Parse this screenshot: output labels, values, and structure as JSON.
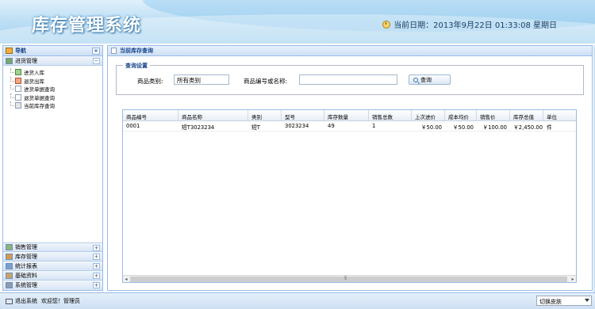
{
  "header": {
    "app_title": "库存管理系统",
    "date_text": "当前日期：2013年9月22日  01:33:08 星期日"
  },
  "nav": {
    "title": "导航",
    "collapse_symbol": "«",
    "sections_top": [
      {
        "label": "进货管理",
        "toggle": "−",
        "items": [
          "进货入库",
          "退货出库",
          "进货单据查询",
          "退货单据查询",
          "当前库存查询"
        ]
      }
    ],
    "sections_bottom": [
      {
        "label": "销售管理",
        "toggle": "+"
      },
      {
        "label": "库存管理",
        "toggle": "+"
      },
      {
        "label": "统计报表",
        "toggle": "+"
      },
      {
        "label": "基础资料",
        "toggle": "+"
      },
      {
        "label": "系统管理",
        "toggle": "+"
      }
    ]
  },
  "main": {
    "panel_title": "当前库存查询",
    "query": {
      "legend": "查询设置",
      "category_label": "商品类别:",
      "category_value": "所有类别",
      "code_label": "商品编号或名称:",
      "code_value": "",
      "search_button": "查询"
    },
    "grid": {
      "columns": [
        "商品编号",
        "商品名称",
        "类别",
        "型号",
        "库存数量",
        "销售总数",
        "上次进价",
        "成本均价",
        "销售价",
        "库存总值",
        "单位"
      ],
      "rows": [
        [
          "0001",
          "短T3023234",
          "短T",
          "3023234",
          "49",
          "1",
          "￥50.00",
          "￥50.00",
          "￥100.00",
          "￥2,450.00",
          "件"
        ]
      ]
    }
  },
  "footer": {
    "logout": "退出系统",
    "welcome": "欢迎您！管理员",
    "skin_select": "切换皮肤"
  }
}
